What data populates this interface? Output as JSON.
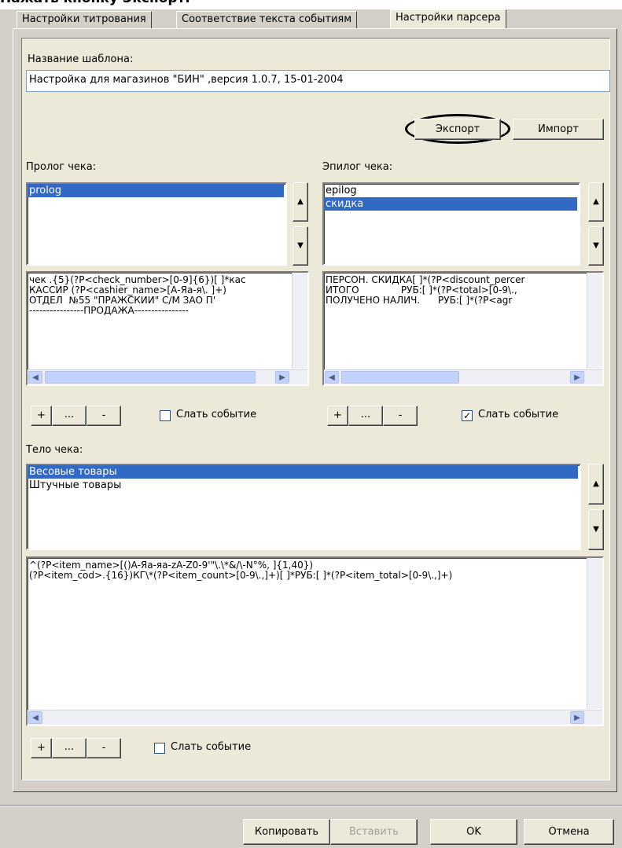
{
  "caption": "Нажать кнопку Экспорт.",
  "tabs": [
    {
      "label": "Настройки титрования"
    },
    {
      "label": "Соответствие текста событиям"
    },
    {
      "label": "Настройки парсера"
    }
  ],
  "template": {
    "label": "Название шаблона:",
    "value": "Настройка для магазинов \"БИН\" ,версия 1.0.7, 15-01-2004"
  },
  "export_button": "Экспорт",
  "import_button": "Импорт",
  "prolog": {
    "label": "Пролог чека:",
    "items": [
      "prolog"
    ],
    "text_lines": [
      "чек .{5}(?P<check_number>[0-9]{6})[ ]*кас",
      "КАССИР (?P<cashier_name>[А-Яа-я\\. ]+)",
      "ОТДЕЛ  №55 \"ПРАЖСКИЙ\" С/М ЗАО П'",
      "----------------ПРОДАЖА----------------"
    ],
    "send_event": "Слать событие",
    "send_event_checked": false
  },
  "epilog": {
    "label": "Эпилог чека:",
    "items": [
      "epilog",
      "скидка"
    ],
    "text_lines": [
      "ПЕРСОН. СКИДКА[ ]*(?P<discount_percer",
      "ИТОГО              РУБ:[ ]*(?P<total>[0-9\\.,",
      "ПОЛУЧЕНО НАЛИЧ.      РУБ:[ ]*(?P<agr"
    ],
    "send_event": "Слать событие",
    "send_event_checked": true
  },
  "body": {
    "label": "Тело чека:",
    "items": [
      "Весовые товары",
      "Штучные товары"
    ],
    "text_lines": [
      "^(?P<item_name>[()A-Яа-яa-zA-Z0-9'\"\\.\\*&/\\-N°%, ]{1,40})",
      "(?P<item_cod>.{16})КГ\\*(?P<item_count>[0-9\\.,]+)[ ]*РУБ:[ ]*(?P<item_total>[0-9\\.,]+)"
    ],
    "send_event": "Слать событие",
    "send_event_checked": false
  },
  "small_buttons": {
    "add": "+",
    "edit": "...",
    "remove": "-"
  },
  "check_mark": "✓",
  "footer": {
    "copy": "Копировать",
    "paste": "Вставить",
    "ok": "OK",
    "cancel": "Отмена"
  },
  "icons": {
    "scroll_up": "▲",
    "scroll_down": "▼",
    "scroll_left": "◀",
    "scroll_right": "▶"
  }
}
